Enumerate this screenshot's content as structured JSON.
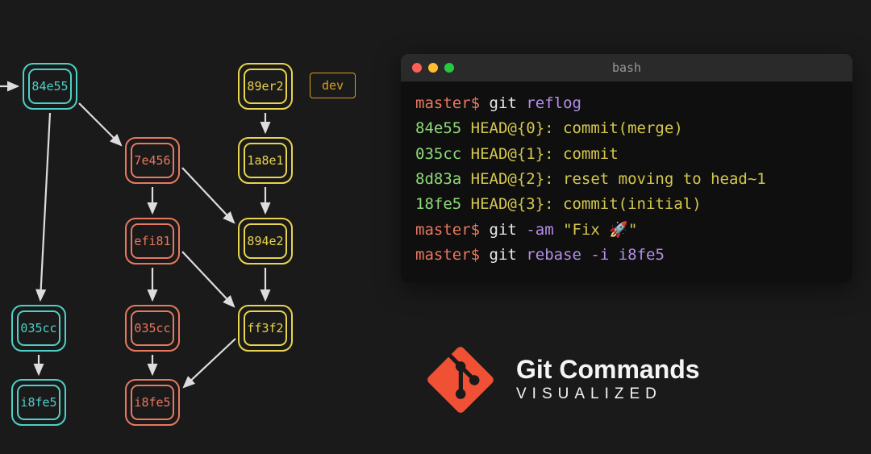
{
  "graph": {
    "columns": {
      "cyan": [
        "84e55",
        "035cc",
        "i8fe5"
      ],
      "coral": [
        "7e456",
        "efi81",
        "035cc",
        "i8fe5"
      ],
      "yellow": [
        "89er2",
        "1a8e1",
        "894e2",
        "ff3f2"
      ]
    },
    "branch_tag": "dev"
  },
  "terminal": {
    "title": "bash",
    "lines": {
      "l1_prompt": "master$",
      "l1_cmd_a": "git",
      "l1_cmd_b": "reflog",
      "r1_hash": "84e55",
      "r1_txt": "HEAD@{0}: commit(merge)",
      "r2_hash": "035cc",
      "r2_txt": "HEAD@{1}: commit",
      "r3_hash": "8d83a",
      "r3_txt": "HEAD@{2}: reset moving to head~1",
      "r4_hash": "18fe5",
      "r4_txt": "HEAD@{3}: commit(initial)",
      "l2_prompt": "master$",
      "l2_cmd_a": "git",
      "l2_cmd_b": "-am",
      "l2_str": "\"Fix 🚀\"",
      "l3_prompt": "master$",
      "l3_cmd_a": "git",
      "l3_cmd_b": "rebase",
      "l3_cmd_c": "-i i8fe5"
    }
  },
  "brand": {
    "title": "Git Commands",
    "subtitle": "VISUALIZED"
  },
  "colors": {
    "cyan": "#4dd0c7",
    "coral": "#e8785e",
    "yellow": "#e8d44d",
    "accent": "#f05033"
  }
}
